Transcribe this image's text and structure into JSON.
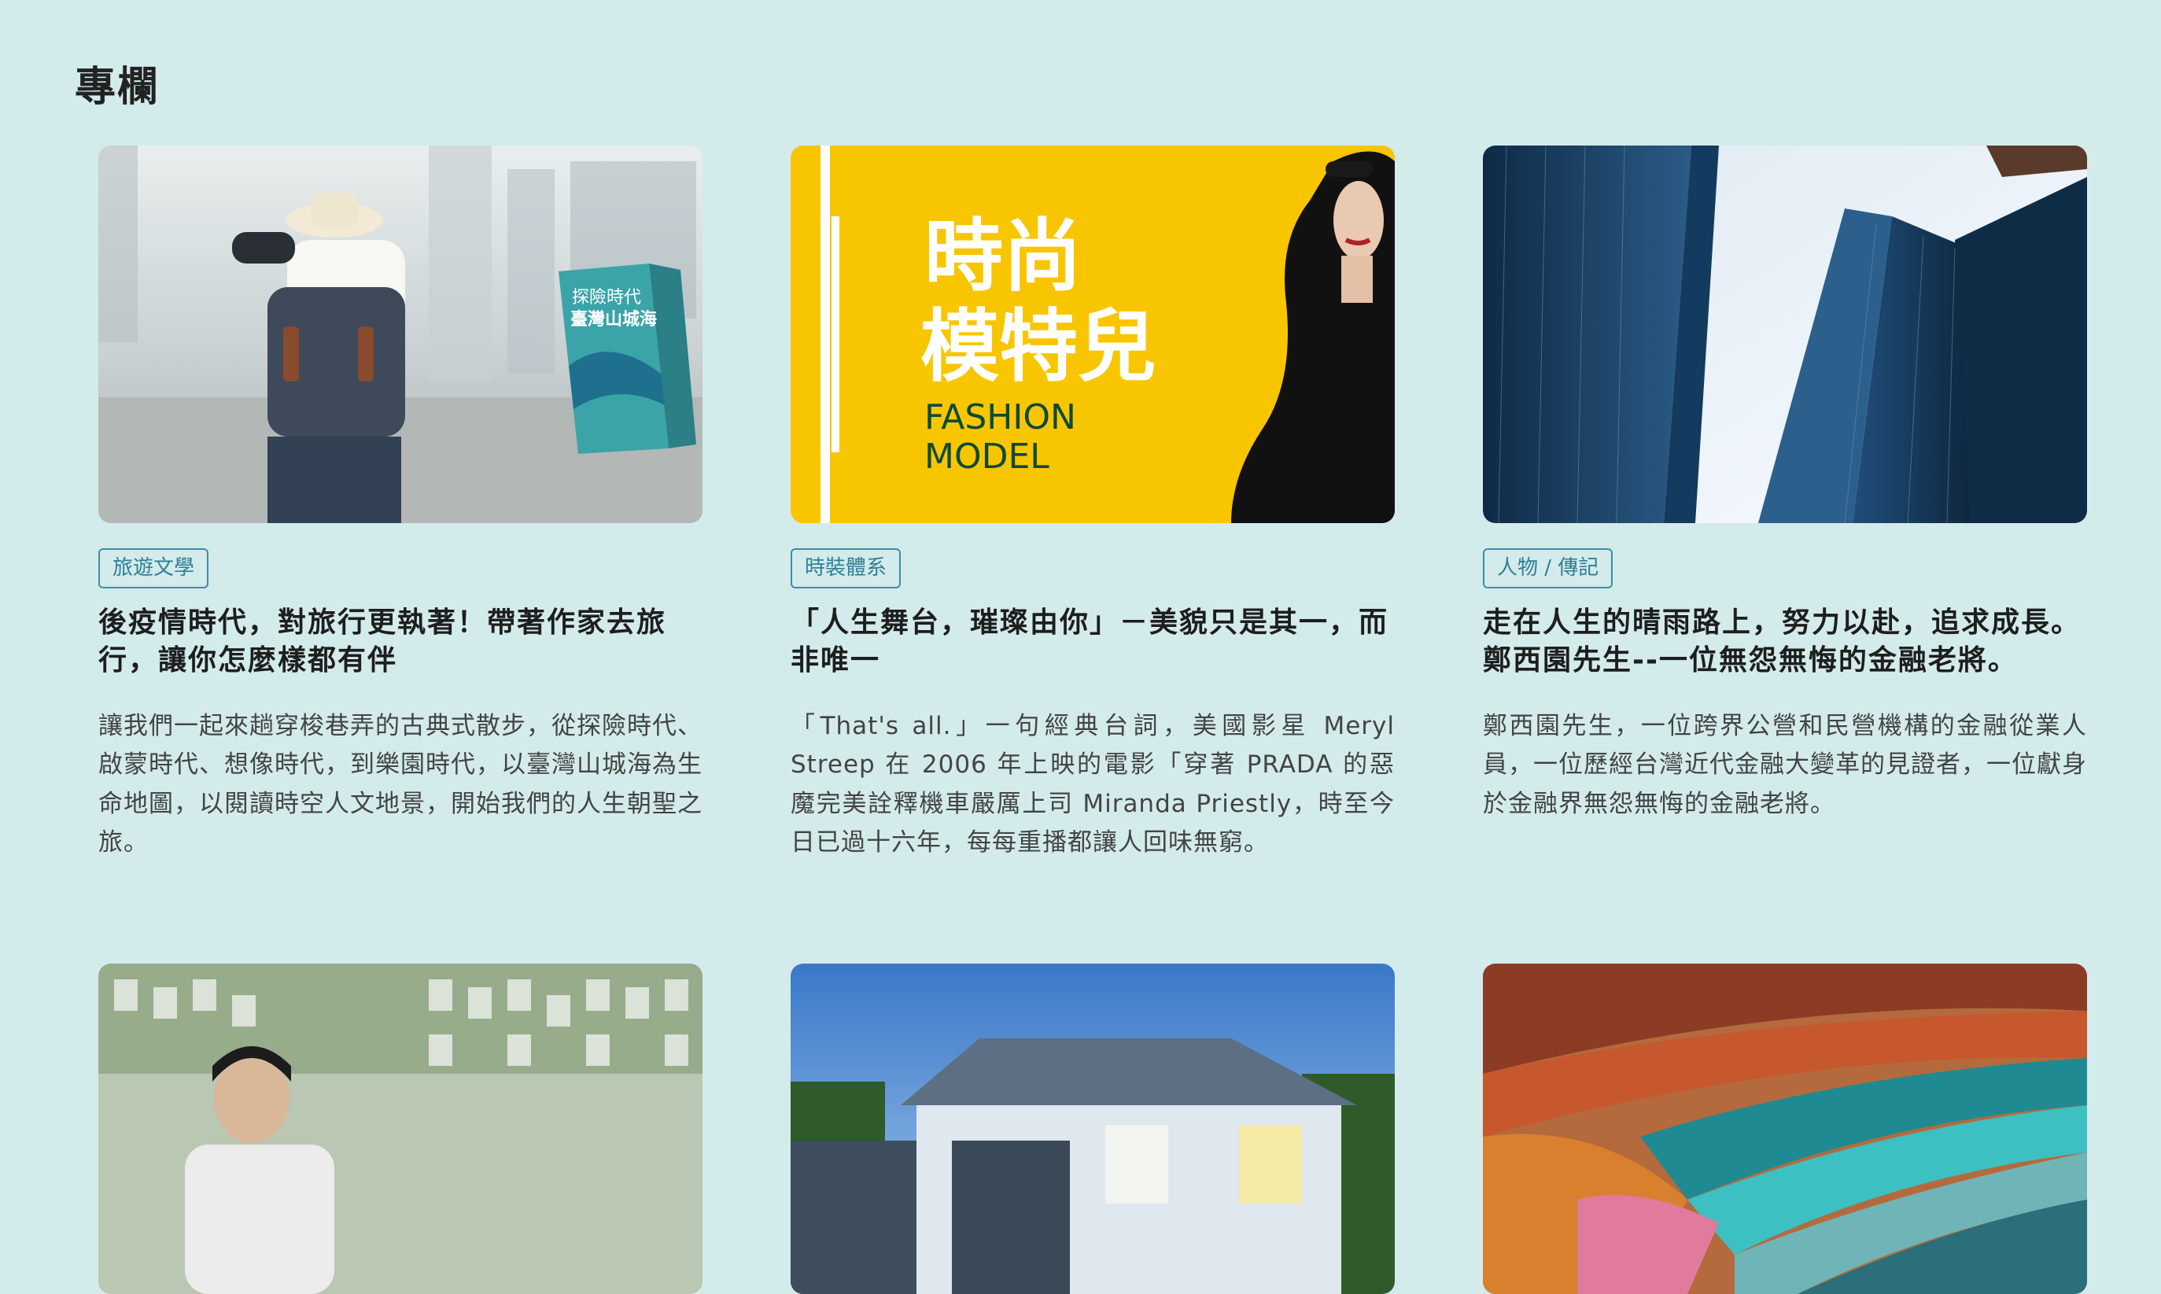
{
  "section": {
    "title": "專欄"
  },
  "articles": [
    {
      "tag": "旅遊文學",
      "title": "後疫情時代，對旅行更執著！帶著作家去旅行，讓你怎麼樣都有伴",
      "desc": "讓我們一起來趟穿梭巷弄的古典式散步，從探險時代、啟蒙時代、想像時代，到樂園時代，以臺灣山城海為生命地圖，以閱讀時空人文地景，開始我們的人生朝聖之旅。",
      "image": {
        "book_title_line1": "探險時代",
        "book_title_line2": "臺灣山城海"
      }
    },
    {
      "tag": "時裝體系",
      "title": "「人生舞台，璀璨由你」－美貌只是其一，而非唯一",
      "desc": "「That's all.」一句經典台詞，美國影星 Meryl Streep 在 2006 年上映的電影「穿著 PRADA 的惡魔完美詮釋機車嚴厲上司 Miranda Priestly，時至今日已過十六年，每每重播都讓人回味無窮。",
      "image": {
        "line1": "時尚",
        "line2": "模特兒",
        "line3": "FASHION",
        "line4": "MODEL"
      }
    },
    {
      "tag": "人物 / 傳記",
      "title": "走在人生的晴雨路上，努力以赴，追求成長。鄭西園先生--一位無怨無悔的金融老將。",
      "desc": "鄭西園先生，一位跨界公營和民營機構的金融從業人員，一位歷經台灣近代金融大變革的見證者，一位獻身於金融界無怨無悔的金融老將。"
    },
    {},
    {},
    {}
  ],
  "colors": {
    "background": "#d3ebeb",
    "tag_border": "#3b8fa6",
    "fashion_yellow": "#f8c600"
  }
}
